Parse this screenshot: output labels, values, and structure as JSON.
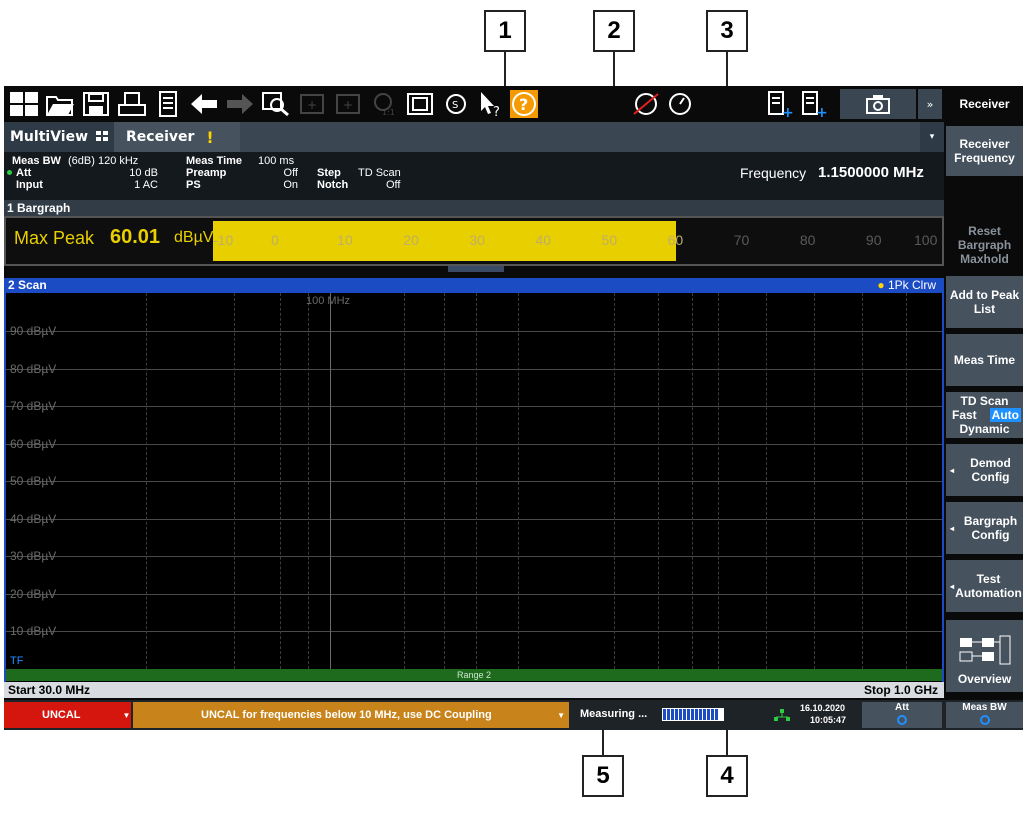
{
  "callouts": [
    "1",
    "2",
    "3",
    "4",
    "5"
  ],
  "toolbar": {
    "icons": [
      "windows-icon",
      "open-folder-icon",
      "save-icon",
      "print-icon",
      "report-icon",
      "undo-icon",
      "redo-icon",
      "zoom-icon",
      "zoom-plus-icon",
      "zoom-multi-icon",
      "zoom-1to1-icon",
      "fit-icon",
      "refresh-icon",
      "help-cursor-icon",
      "help-icon",
      "no-signal-icon",
      "clock-icon",
      "add-channel-icon",
      "add-window-icon",
      "camera-icon",
      "more-icon"
    ],
    "more_label": "»"
  },
  "tabs": {
    "multiview": "MultiView",
    "receiver": "Receiver",
    "warning": "!",
    "dropdown": "▾"
  },
  "params": {
    "meas_bw_label": "Meas BW",
    "meas_bw_value": "(6dB) 120 kHz",
    "att_label": "Att",
    "att_value": "10 dB",
    "input_label": "Input",
    "input_value": "1 AC",
    "meas_time_label": "Meas Time",
    "meas_time_value": "100 ms",
    "preamp_label": "Preamp",
    "preamp_value": "Off",
    "ps_label": "PS",
    "ps_value": "On",
    "step_label": "Step",
    "step_value": "TD Scan",
    "notch_label": "Notch",
    "notch_value": "Off",
    "frequency_label": "Frequency",
    "frequency_value": "1.1500000 MHz"
  },
  "bargraph": {
    "title": "1 Bargraph",
    "detector": "Max Peak",
    "value": "60.01",
    "unit": "dBµV",
    "fill_level": 60.01,
    "scale": [
      "-10",
      "0",
      "10",
      "20",
      "30",
      "40",
      "50",
      "60",
      "70",
      "80",
      "90",
      "100"
    ]
  },
  "scan": {
    "title": "2 Scan",
    "trace": "1Pk Clrw",
    "marker_label": "100 MHz",
    "y_labels": [
      "90 dBµV",
      "80 dBµV",
      "70 dBµV",
      "60 dBµV",
      "50 dBµV",
      "40 dBµV",
      "30 dBµV",
      "20 dBµV",
      "10 dBµV"
    ],
    "tf_label": "TF",
    "range_label": "Range 2",
    "start": "Start 30.0 MHz",
    "stop": "Stop 1.0 GHz"
  },
  "status": {
    "uncal": "UNCAL",
    "message": "UNCAL for frequencies below 10 MHz, use DC Coupling",
    "measuring": "Measuring ...",
    "date": "16.10.2020",
    "time": "10:05:47",
    "att": "Att",
    "meas_bw": "Meas BW"
  },
  "softkeys": {
    "title": "Receiver",
    "receiver_frequency": "Receiver Frequency",
    "reset_bargraph": "Reset Bargraph Maxhold",
    "add_peak": "Add to Peak List",
    "meas_time": "Meas Time",
    "td_scan": "TD Scan",
    "td_fast": "Fast",
    "td_auto": "Auto",
    "td_dynamic": "Dynamic",
    "demod": "Demod Config",
    "bargraph_config": "Bargraph Config",
    "test_automation": "Test Automation",
    "overview": "Overview"
  },
  "colors": {
    "accent_blue": "#1b4cc4",
    "bar_yellow": "#e8cf00",
    "uncal_red": "#d4160f",
    "msg_orange": "#c8841a",
    "range_green": "#1e6b1e"
  }
}
